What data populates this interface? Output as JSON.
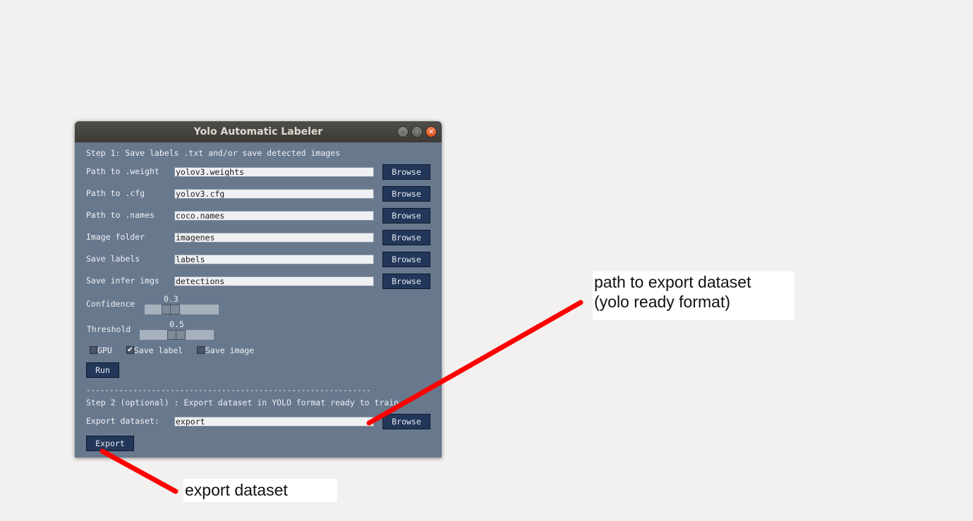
{
  "window": {
    "title": "Yolo Automatic Labeler",
    "controls": {
      "minimize": "–",
      "maximize": "□",
      "close": "×"
    }
  },
  "step1": {
    "heading": "Step 1: Save labels .txt and/or save detected images",
    "rows": [
      {
        "label": "Path to .weight",
        "value": "yolov3.weights",
        "button": "Browse"
      },
      {
        "label": "Path to .cfg",
        "value": "yolov3.cfg",
        "button": "Browse"
      },
      {
        "label": "Path to .names",
        "value": "coco.names",
        "button": "Browse"
      },
      {
        "label": "Image folder",
        "value": "imagenes",
        "button": "Browse"
      },
      {
        "label": "Save labels",
        "value": "labels",
        "button": "Browse"
      },
      {
        "label": "Save infer imgs",
        "value": "detections",
        "button": "Browse"
      }
    ],
    "confidence": {
      "label": "Confidence",
      "value": "0.3"
    },
    "threshold": {
      "label": "Threshold",
      "value": "0.5"
    },
    "checkboxes": [
      {
        "label": "GPU",
        "checked": false
      },
      {
        "label": "Save label",
        "checked": true
      },
      {
        "label": "Save image",
        "checked": false
      }
    ],
    "run_button": "Run"
  },
  "divider": "-------------------------------------------------------------",
  "step2": {
    "heading": "Step 2 (optional) : Export dataset in YOLO format ready to train",
    "export_label": "Export dataset:",
    "export_value": "export",
    "browse_button": "Browse",
    "export_button": "Export"
  },
  "annotations": {
    "path_note_line1": "path to export dataset",
    "path_note_line2": "(yolo ready format)",
    "export_note": "export dataset",
    "arrow_color": "#ff0000"
  }
}
